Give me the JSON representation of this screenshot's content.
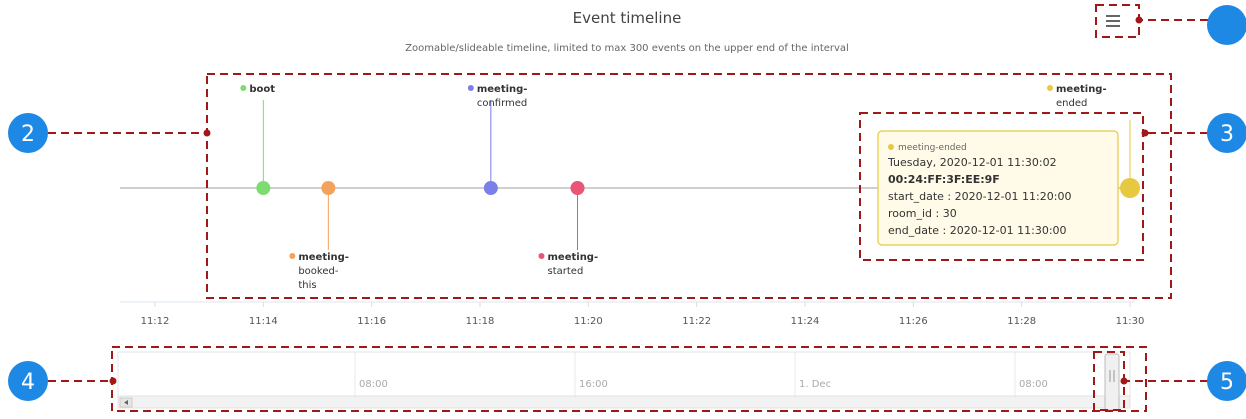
{
  "chart_data": {
    "type": "timeline",
    "title": "Event timeline",
    "subtitle": "Zoomable/slideable timeline, limited to max 300 events on the upper end of the interval",
    "x_ticks": [
      "11:12",
      "11:14",
      "11:16",
      "11:18",
      "11:20",
      "11:22",
      "11:24",
      "11:26",
      "11:28",
      "11:30"
    ],
    "x_range": [
      "11:12",
      "11:30"
    ],
    "events": [
      {
        "time": "11:14.0",
        "name": "boot",
        "label": [
          "boot"
        ],
        "color": "#7ddc6f",
        "label_pos": "above"
      },
      {
        "time": "11:15.2",
        "name": "meeting-booked-this",
        "label": [
          "meeting-",
          "booked-",
          "this"
        ],
        "color": "#f4a25b",
        "label_pos": "below"
      },
      {
        "time": "11:18.2",
        "name": "meeting-confirmed",
        "label": [
          "meeting-",
          "confirmed"
        ],
        "color": "#7b80e8",
        "label_pos": "above"
      },
      {
        "time": "11:19.8",
        "name": "meeting-started",
        "label": [
          "meeting-",
          "started"
        ],
        "color": "#e85575",
        "label_pos": "below"
      },
      {
        "time": "11:30.0",
        "name": "meeting-ended",
        "label": [
          "meeting-",
          "ended"
        ],
        "color": "#e6c940",
        "label_pos": "above"
      }
    ],
    "tooltip": {
      "series": "meeting-ended",
      "lines": [
        "Tuesday, 2020-12-01 11:30:02",
        "00:24:FF:3F:EE:9F",
        "start_date : 2020-12-01 11:20:00",
        "room_id : 30",
        "end_date : 2020-12-01 11:30:00"
      ],
      "color": "#e6c940"
    },
    "navigator_labels": [
      "08:00",
      "16:00",
      "1. Dec",
      "08:00"
    ],
    "grid": false
  },
  "menu": {
    "icon": "hamburger-menu-icon"
  },
  "callouts": [
    "2",
    "3",
    "4",
    "5"
  ],
  "colors": {
    "callout": "#1e88e5",
    "annotation": "#a01818",
    "axis": "#cccccc"
  }
}
